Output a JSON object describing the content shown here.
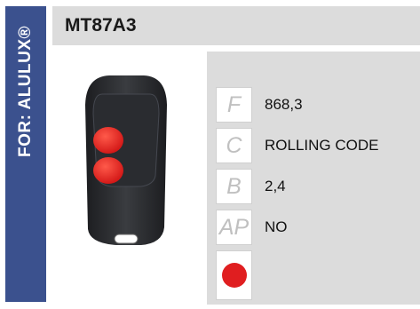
{
  "sidebar": {
    "text": "FOR: ALULUX®"
  },
  "product": {
    "model": "MT87A3"
  },
  "specs": [
    {
      "key": "F",
      "value": "868,3"
    },
    {
      "key": "C",
      "value": "ROLLING CODE"
    },
    {
      "key": "B",
      "value": "2,4"
    },
    {
      "key": "AP",
      "value": "NO"
    }
  ],
  "colors": {
    "sidebar": "#3b518e",
    "header": "#dcdcdc",
    "remote_body": "#2b2d30",
    "buttons": "#e01e20"
  }
}
